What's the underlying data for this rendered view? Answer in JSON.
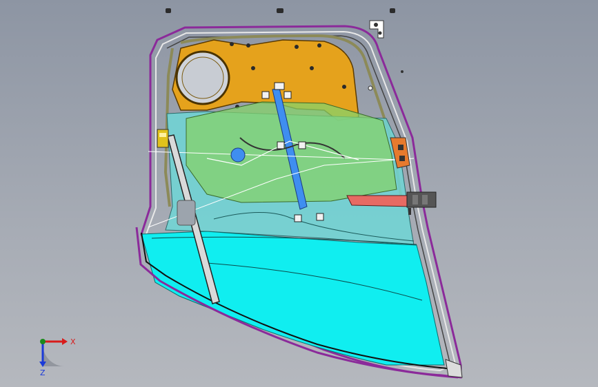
{
  "viewport": {
    "background_top": "#8f97a5",
    "background_bottom": "#b3b7bd"
  },
  "model": {
    "colors": {
      "outer_seal": "#8b2a9a",
      "inner_panel": "#e5a21c",
      "glass_upper": "#6fd6d6",
      "glass_lower": "#10eef0",
      "regulator": "#3f8ef0",
      "green_overlay": "#86d26a",
      "handle": "#e76a63",
      "bracket": "#e67a2e"
    }
  },
  "axis": {
    "x_label": "X",
    "y_label": "Z",
    "colors": {
      "x": "#d81b1b",
      "y": "#1b8a1b",
      "z": "#1b3ad8"
    }
  }
}
